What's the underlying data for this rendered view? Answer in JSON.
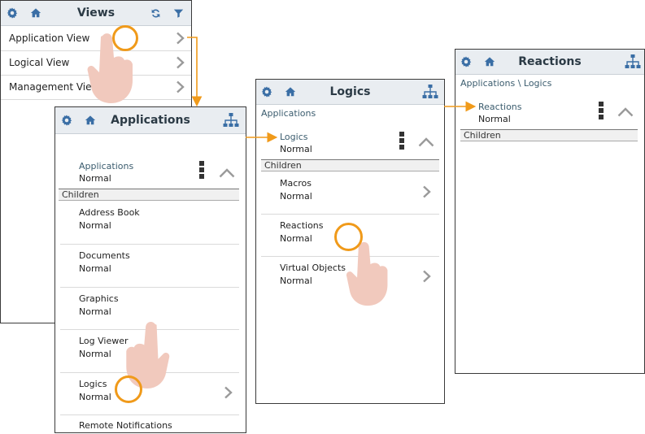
{
  "colors": {
    "accent": "#f09a1a",
    "header": "#e9edf1",
    "icon_blue": "#3a6ea5"
  },
  "views": {
    "title": "Views",
    "items": [
      {
        "label": "Application View"
      },
      {
        "label": "Logical View"
      },
      {
        "label": "Management View"
      }
    ]
  },
  "applications": {
    "title": "Applications",
    "current": {
      "name": "Applications",
      "status": "Normal"
    },
    "children_label": "Children",
    "children": [
      {
        "name": "Address Book",
        "status": "Normal"
      },
      {
        "name": "Documents",
        "status": "Normal"
      },
      {
        "name": "Graphics",
        "status": "Normal"
      },
      {
        "name": "Log Viewer",
        "status": "Normal"
      },
      {
        "name": "Logics",
        "status": "Normal"
      },
      {
        "name": "Remote Notifications",
        "status": ""
      }
    ]
  },
  "logics": {
    "title": "Logics",
    "breadcrumb": "Applications",
    "current": {
      "name": "Logics",
      "status": "Normal"
    },
    "children_label": "Children",
    "children": [
      {
        "name": "Macros",
        "status": "Normal"
      },
      {
        "name": "Reactions",
        "status": "Normal"
      },
      {
        "name": "Virtual Objects",
        "status": "Normal"
      }
    ]
  },
  "reactions": {
    "title": "Reactions",
    "breadcrumb": "Applications \\ Logics",
    "current": {
      "name": "Reactions",
      "status": "Normal"
    },
    "children_label": "Children"
  },
  "icons": [
    "gear-icon",
    "home-icon",
    "refresh-icon",
    "filter-icon",
    "hierarchy-icon",
    "chevron-right-icon",
    "chevron-up-icon",
    "more-vertical-icon"
  ]
}
